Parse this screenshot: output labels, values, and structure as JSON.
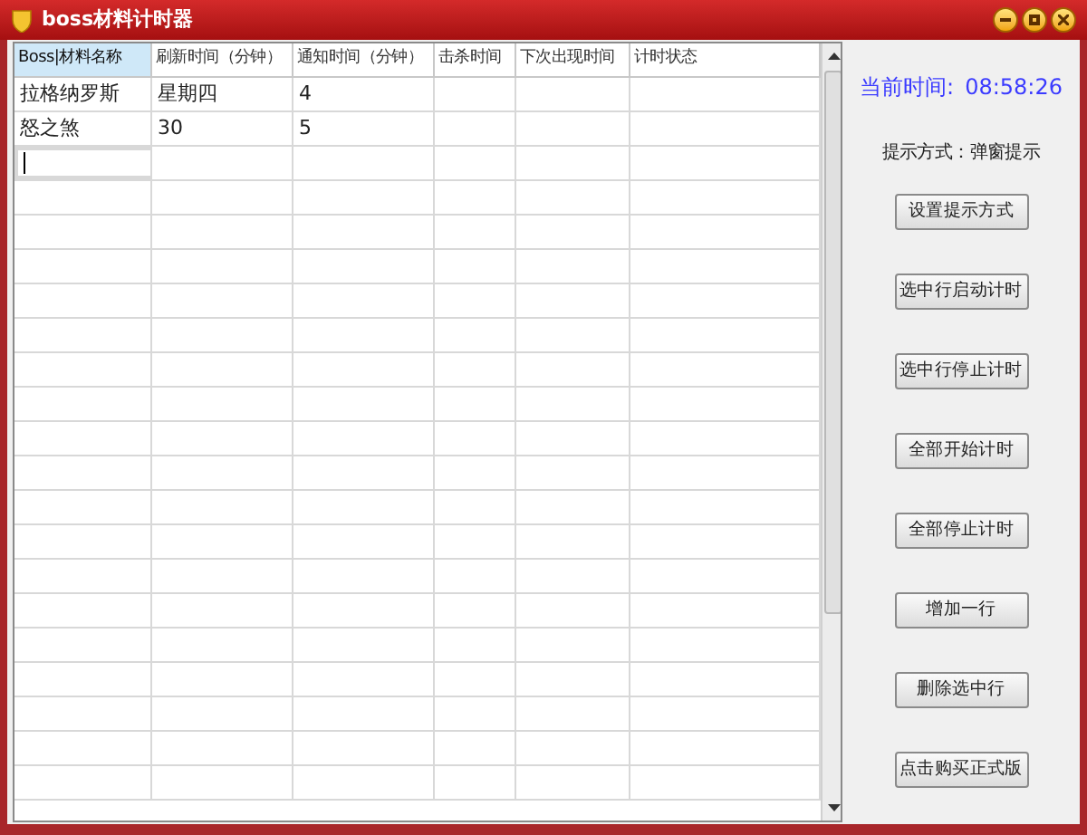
{
  "window": {
    "title": "boss材料计时器"
  },
  "table": {
    "columns": [
      {
        "label": "Boss|材料名称",
        "selected": true
      },
      {
        "label": "刷新时间（分钟）",
        "selected": false
      },
      {
        "label": "通知时间（分钟）",
        "selected": false
      },
      {
        "label": "击杀时间",
        "selected": false
      },
      {
        "label": "下次出现时间",
        "selected": false
      },
      {
        "label": "计时状态",
        "selected": false
      }
    ],
    "rows": [
      {
        "cells": [
          "拉格纳罗斯",
          "星期四",
          "4"
        ]
      },
      {
        "cells": [
          "怒之煞",
          "30",
          "5"
        ]
      }
    ],
    "new_row": {
      "editing": true
    }
  },
  "side_panel": {
    "clock": {
      "label": "当前时间:",
      "time": "08:58:26"
    },
    "notify_mode": "提示方式：弹窗提示",
    "buttons": [
      "设置提示方式",
      "选中行启动计时",
      "选中行停止计时",
      "全部开始计时",
      "全部停止计时",
      "增加一行",
      "删除选中行",
      "点击购买正式版"
    ]
  }
}
